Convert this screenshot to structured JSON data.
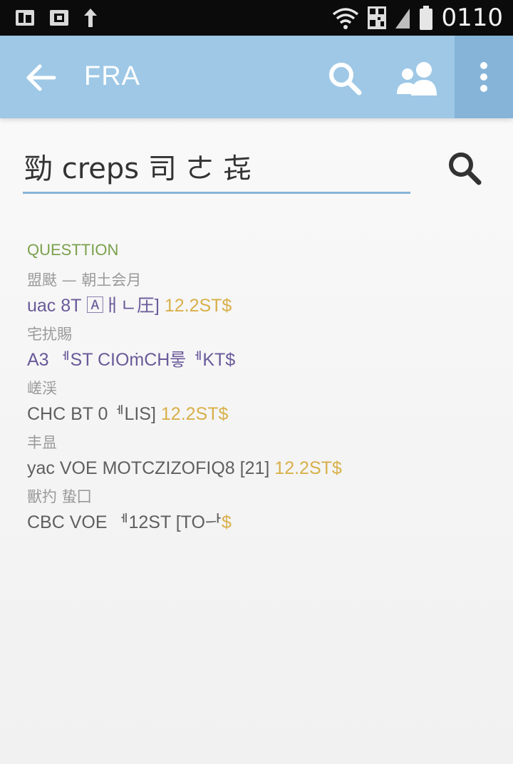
{
  "status_bar": {
    "time": "0110",
    "left_icons": [
      "gallery-icon",
      "image-icon",
      "upload-icon"
    ],
    "right_icons": [
      "wifi-icon",
      "qr-icon",
      "signal-icon",
      "battery-icon"
    ]
  },
  "app_bar": {
    "title": "FRA",
    "color": "#9ec8e6",
    "accent_color": "#86b4d8"
  },
  "search": {
    "value": "勁 creps 司 ㄜ 㐂"
  },
  "results": {
    "section_header": "QUESTTION",
    "items": [
      {
        "sub": "盟颫 — 朝土会月",
        "main": "uac 8T 🄰ㅐㄴ圧]",
        "accent": "12.2ST$"
      },
      {
        "sub": "宅扰賜",
        "main": "A3 ᅦST CIOṁCH뤃ᅦKT$",
        "accent": ""
      },
      {
        "sub": "嵯渓",
        "main": "CHC BT 0ᅦLIS]",
        "accent": "12.2ST$"
      },
      {
        "sub": "丰昷",
        "main": "yac VOE MOTCZIZOFIQ8 [21]",
        "accent": "12.2ST$"
      },
      {
        "sub": "獸扚 蛰囗",
        "main": "CBC VOE ᅦ12ST [TOᅳ",
        "accent": "ᅡ$"
      }
    ]
  }
}
